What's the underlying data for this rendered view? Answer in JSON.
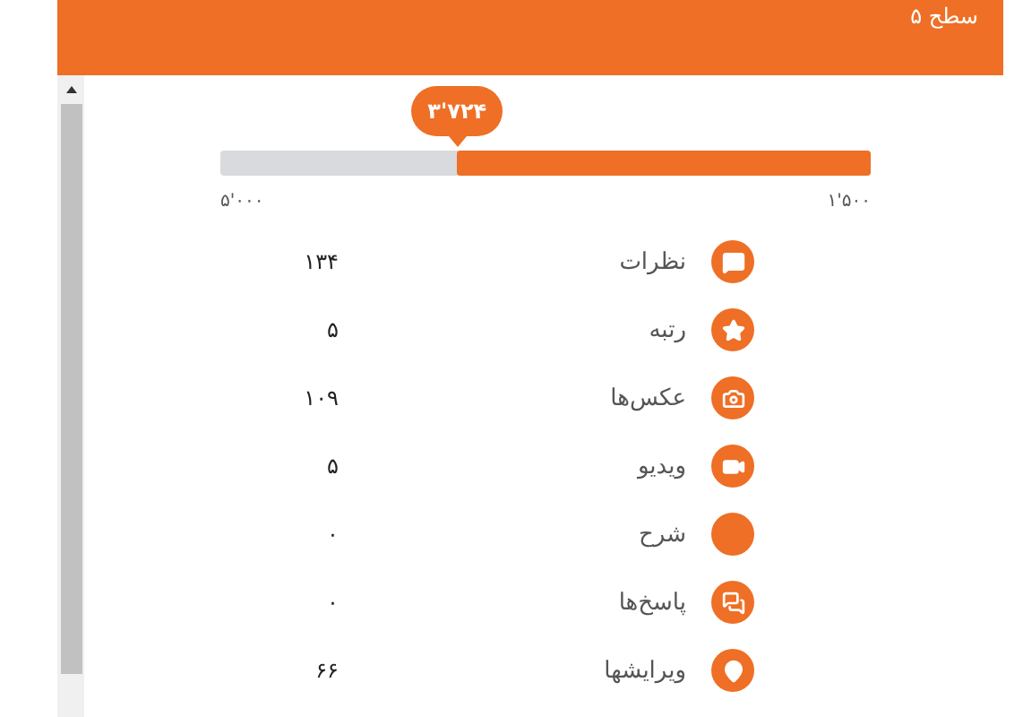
{
  "header": {
    "title": "سطح ۵"
  },
  "progress": {
    "level": 0.636,
    "bubble": "۳'۷۲۴",
    "start_label": "۱'۵۰۰",
    "end_label": "۵'۰۰۰"
  },
  "stats": [
    {
      "kind": "review",
      "label": "نظرات",
      "value": "۱۳۴"
    },
    {
      "kind": "rating",
      "label": "رتبه",
      "value": "۵"
    },
    {
      "kind": "photo",
      "label": "عکس‌ها",
      "value": "۱۰۹"
    },
    {
      "kind": "video",
      "label": "ویدیو",
      "value": "۵"
    },
    {
      "kind": "blank",
      "label": "شرح",
      "value": "۰"
    },
    {
      "kind": "answer",
      "label": "پاسخ‌ها",
      "value": "۰"
    },
    {
      "kind": "edit",
      "label": "ویرایشها",
      "value": "۶۶"
    }
  ]
}
